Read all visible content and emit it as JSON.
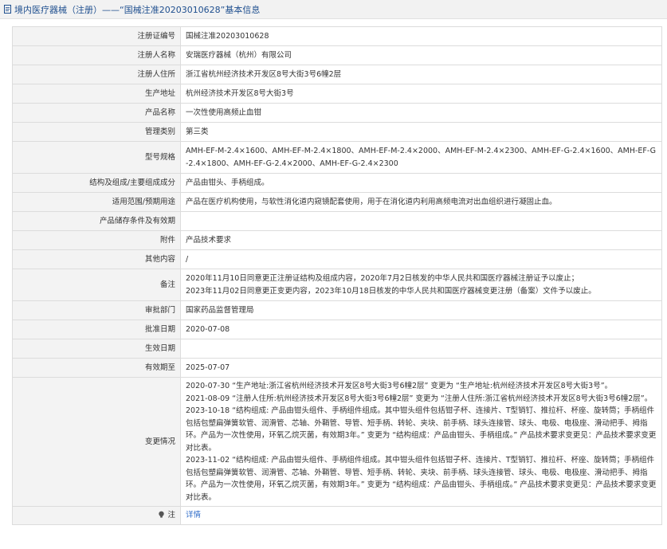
{
  "header": {
    "title": "境内医疗器械（注册）——“国械注准20203010628”基本信息"
  },
  "rows": [
    {
      "label": "注册证编号",
      "value": "国械注准20203010628"
    },
    {
      "label": "注册人名称",
      "value": "安瑞医疗器械（杭州）有限公司"
    },
    {
      "label": "注册人住所",
      "value": "浙江省杭州经济技术开发区8号大街3号6幢2层"
    },
    {
      "label": "生产地址",
      "value": "杭州经济技术开发区8号大街3号"
    },
    {
      "label": "产品名称",
      "value": "一次性使用高频止血钳"
    },
    {
      "label": "管理类别",
      "value": "第三类"
    },
    {
      "label": "型号规格",
      "value": "AMH-EF-M-2.4×1600、AMH-EF-M-2.4×1800、AMH-EF-M-2.4×2000、AMH-EF-M-2.4×2300、AMH-EF-G-2.4×1600、AMH-EF-G-2.4×1800、AMH-EF-G-2.4×2000、AMH-EF-G-2.4×2300"
    },
    {
      "label": "结构及组成/主要组成成分",
      "value": "产品由钳头、手柄组成。"
    },
    {
      "label": "适用范围/预期用途",
      "value": "产品在医疗机构使用，与软性消化道内窥镜配套使用，用于在消化道内利用高频电流对出血组织进行凝固止血。"
    },
    {
      "label": "产品储存条件及有效期",
      "value": ""
    },
    {
      "label": "附件",
      "value": "产品技术要求"
    },
    {
      "label": "其他内容",
      "value": "/"
    },
    {
      "label": "备注",
      "lines": [
        "2020年11月10日同意更正注册证结构及组成内容，2020年7月2日核发的中华人民共和国医疗器械注册证予以废止；",
        "2023年11月02日同意更正变更内容，2023年10月18日核发的中华人民共和国医疗器械变更注册（备案）文件予以废止。"
      ]
    },
    {
      "label": "审批部门",
      "value": "国家药品监督管理局"
    },
    {
      "label": "批准日期",
      "value": "2020-07-08"
    },
    {
      "label": "生效日期",
      "value": ""
    },
    {
      "label": "有效期至",
      "value": "2025-07-07"
    },
    {
      "label": "变更情况",
      "lines": [
        "2020-07-30 “生产地址:浙江省杭州经济技术开发区8号大街3号6幢2层” 变更为 “生产地址:杭州经济技术开发区8号大街3号”。",
        "2021-08-09 “注册人住所:杭州经济技术开发区8号大街3号6幢2层” 变更为 “注册人住所:浙江省杭州经济技术开发区8号大街3号6幢2层”。",
        "2023-10-18 “结构组成: 产品由钳头组件、手柄组件组成。其中钳头组件包括钳子杯、连接片、T型销钉、推拉杆、杯座、旋转筒；手柄组件包括包塑扁弹簧软管、润滑管、芯轴、外鞘管、导管、短手柄、转轮、夹块、前手柄、球头连接管、球头、电极、电极座、滑动把手、拇指环。产品为一次性使用，环氧乙烷灭菌，有效期3年。” 变更为 “结构组成：产品由钳头、手柄组成。” 产品技术要求变更见：产品技术要求变更对比表。",
        "2023-11-02 “结构组成: 产品由钳头组件、手柄组件组成。其中钳头组件包括钳子杯、连接片、T型销钉、推拉杆、杯座、旋转筒；手柄组件包括包塑扁弹簧软管、润滑管、芯轴、外鞘管、导管、短手柄、转轮、夹块、前手柄、球头连接管、球头、电极、电极座、滑动把手、拇指环。产品为一次性使用，环氧乙烷灭菌，有效期3年。” 变更为 “结构组成：产品由钳头、手柄组成。” 产品技术要求变更见：产品技术要求变更对比表。"
      ]
    }
  ],
  "note": {
    "label": "注",
    "link_text": "详情"
  },
  "colors": {
    "header_text": "#1f4f8f",
    "label_bg": "#f3f3f3",
    "link": "#2f6cc9",
    "border": "#dcdcdc"
  },
  "icons": {
    "header": "document-icon",
    "note": "lightbulb-icon"
  }
}
